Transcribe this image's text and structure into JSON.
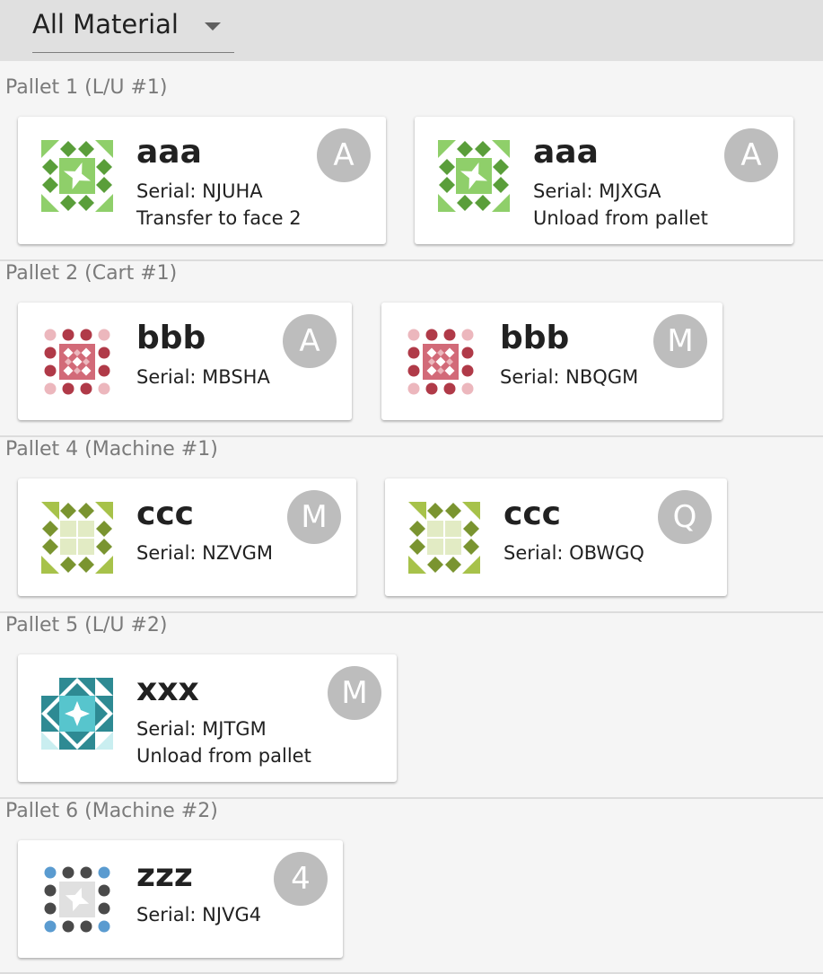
{
  "filter": {
    "value": "All Material"
  },
  "pallets": [
    {
      "label": "Pallet 1 (L/U #1)",
      "cards": [
        {
          "part": "aaa",
          "serial": "Serial: NJUHA",
          "action": "Transfer to face 2",
          "badge": "A",
          "icon": "green-quilt-icon"
        },
        {
          "part": "aaa",
          "serial": "Serial: MJXGA",
          "action": "Unload from pallet",
          "badge": "A",
          "icon": "green-quilt-icon"
        }
      ]
    },
    {
      "label": "Pallet 2 (Cart #1)",
      "cards": [
        {
          "part": "bbb",
          "serial": "Serial: MBSHA",
          "badge": "A",
          "icon": "red-dots-icon"
        },
        {
          "part": "bbb",
          "serial": "Serial: NBQGM",
          "badge": "M",
          "icon": "red-dots-icon"
        }
      ]
    },
    {
      "label": "Pallet 4 (Machine #1)",
      "cards": [
        {
          "part": "ccc",
          "serial": "Serial: NZVGM",
          "badge": "M",
          "icon": "olive-quilt-icon"
        },
        {
          "part": "ccc",
          "serial": "Serial: OBWGQ",
          "badge": "Q",
          "icon": "olive-quilt-icon"
        }
      ]
    },
    {
      "label": "Pallet 5 (L/U #2)",
      "cards": [
        {
          "part": "xxx",
          "serial": "Serial: MJTGM",
          "action": "Unload from pallet",
          "badge": "M",
          "icon": "teal-quilt-icon"
        }
      ]
    },
    {
      "label": "Pallet 6 (Machine #2)",
      "cards": [
        {
          "part": "zzz",
          "serial": "Serial: NJVG4",
          "badge": "4",
          "icon": "gray-dots-icon"
        }
      ]
    }
  ],
  "colors": {
    "green_dark": "#5a9e3a",
    "green_light": "#8fcf6a",
    "red_dark": "#b03a48",
    "red_mid": "#d26a78",
    "red_light": "#ecb7bd",
    "olive_dark": "#7a9430",
    "olive_mid": "#a7c24a",
    "olive_light": "#e2ebc4",
    "teal_dark": "#2e8a93",
    "teal_mid": "#57c5cd",
    "teal_light": "#c9eef0",
    "gray_dark": "#4a4a4a",
    "gray_light": "#e0e0e0",
    "blue": "#5a9bd0",
    "avatar_bg": "#bdbdbd"
  }
}
